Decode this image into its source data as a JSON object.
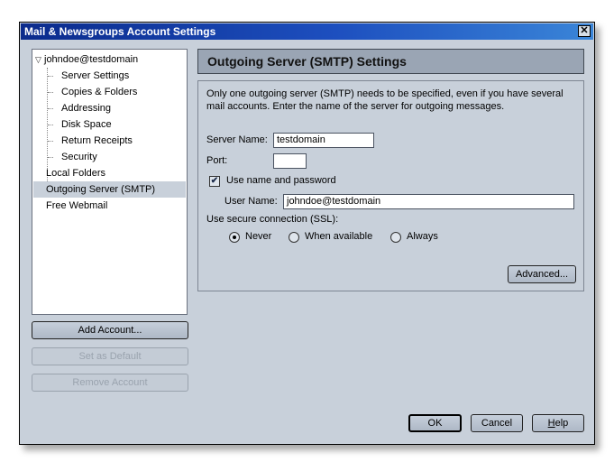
{
  "window": {
    "title": "Mail & Newsgroups Account Settings",
    "close_glyph": "✕"
  },
  "tree": {
    "account": {
      "twisty": "▽",
      "label": "johndoe@testdomain",
      "expanded": true
    },
    "children": [
      {
        "label": "Server Settings"
      },
      {
        "label": "Copies & Folders"
      },
      {
        "label": "Addressing"
      },
      {
        "label": "Disk Space"
      },
      {
        "label": "Return Receipts"
      },
      {
        "label": "Security"
      }
    ],
    "top_items": [
      {
        "label": "Local Folders",
        "selected": false
      },
      {
        "label": "Outgoing Server (SMTP)",
        "selected": true
      },
      {
        "label": "Free Webmail",
        "selected": false
      }
    ]
  },
  "account_buttons": {
    "add": "Add Account...",
    "set_default": "Set as Default",
    "remove": "Remove Account"
  },
  "panel": {
    "header": "Outgoing Server (SMTP) Settings",
    "description": "Only one outgoing server (SMTP) needs to be specified, even if you have several mail accounts. Enter the name of the server for outgoing messages.",
    "server_name_label": "Server Name:",
    "server_name_value": "testdomain",
    "port_label": "Port:",
    "port_value": "",
    "use_name_password_label": "Use name and password",
    "use_name_password_checked": true,
    "check_glyph": "✔",
    "user_name_label": "User Name:",
    "user_name_value": "johndoe@testdomain",
    "ssl_label": "Use secure connection (SSL):",
    "ssl_options": [
      {
        "label": "Never",
        "selected": true
      },
      {
        "label": "When available",
        "selected": false
      },
      {
        "label": "Always",
        "selected": false
      }
    ],
    "advanced_button": "Advanced..."
  },
  "footer": {
    "ok": "OK",
    "cancel": "Cancel",
    "help_mnemonic": "H",
    "help_rest": "elp"
  }
}
